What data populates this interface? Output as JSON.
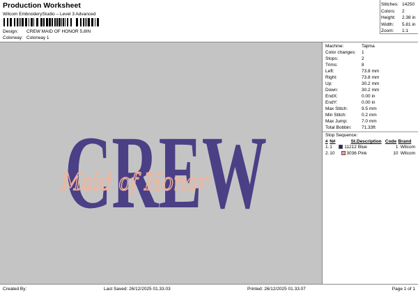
{
  "header": {
    "title": "Production Worksheet",
    "subtitle": "Wilcom EmbroideryStudio – Level 3 Advanced",
    "design_label": "Design:",
    "design": "CREW MAID OF HONOR 5,8IN",
    "colorway_label": "Colorway:",
    "colorway": "Colorway 1"
  },
  "summary": [
    {
      "k": "Stitches:",
      "v": "14250"
    },
    {
      "k": "Colors:",
      "v": "2"
    },
    {
      "k": "Height:",
      "v": "2.38 in"
    },
    {
      "k": "Width:",
      "v": "5.81 in"
    },
    {
      "k": "Zoom:",
      "v": "1:1"
    }
  ],
  "design_art": {
    "main_text": "CREW",
    "script_text": "Maid of Honor",
    "main_color": "#4b3f86",
    "script_color": "#f2b59a",
    "background": "#c4c4c4"
  },
  "details": [
    {
      "k": "Machine:",
      "v": "Tajima"
    },
    {
      "k": "Color changes:",
      "v": "1"
    },
    {
      "k": "Stops:",
      "v": "2"
    },
    {
      "k": "Trims:",
      "v": "8"
    },
    {
      "k": "Left:",
      "v": "73.8 mm"
    },
    {
      "k": "Right:",
      "v": "73.8 mm"
    },
    {
      "k": "Up:",
      "v": "30.2 mm"
    },
    {
      "k": "Down:",
      "v": "30.2 mm"
    },
    {
      "k": "EndX:",
      "v": "0.00 in"
    },
    {
      "k": "EndY:",
      "v": "0.00 in"
    },
    {
      "k": "Max Stitch:",
      "v": "9.5 mm"
    },
    {
      "k": "Min Stitch:",
      "v": "0.2 mm"
    },
    {
      "k": "Max Jump:",
      "v": "7.0 mm"
    },
    {
      "k": "Total Bobbin:",
      "v": "71.33ft"
    }
  ],
  "stop_sequence": {
    "title": "Stop Sequence:",
    "headers": [
      "#",
      "N#",
      "St.",
      "Description",
      "Code",
      "Brand"
    ],
    "rows": [
      {
        "n": "1.",
        "needle": "1",
        "color": "#2a2380",
        "st": "11212",
        "desc": "Blue",
        "code": "1",
        "brand": "Wilcom"
      },
      {
        "n": "2.",
        "needle": "10",
        "color": "#f0a0a0",
        "st": "3036",
        "desc": "Pink",
        "code": "10",
        "brand": "Wilcom"
      }
    ]
  },
  "footer": {
    "created": "Created By:",
    "saved": "Last Saved: 26/12/2025 01.33.03",
    "printed": "Printed: 26/12/2025 01.33.07",
    "page": "Page 1 of 1"
  }
}
